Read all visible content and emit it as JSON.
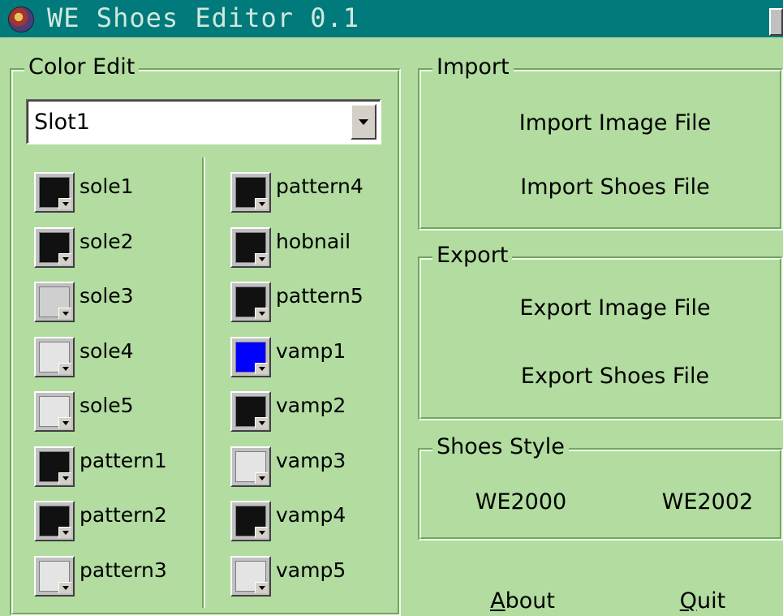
{
  "window": {
    "title": "WE Shoes Editor 0.1"
  },
  "color_edit": {
    "legend": "Color Edit",
    "slot_select": {
      "value": "Slot1"
    },
    "left_column": [
      {
        "label": "sole1",
        "color": "#111111"
      },
      {
        "label": "sole2",
        "color": "#111111"
      },
      {
        "label": "sole3",
        "color": "#cfcfcf"
      },
      {
        "label": "sole4",
        "color": "#e4e4e4"
      },
      {
        "label": "sole5",
        "color": "#e4e4e4"
      },
      {
        "label": "pattern1",
        "color": "#111111"
      },
      {
        "label": "pattern2",
        "color": "#111111"
      },
      {
        "label": "pattern3",
        "color": "#e4e4e4"
      }
    ],
    "right_column": [
      {
        "label": "pattern4",
        "color": "#111111"
      },
      {
        "label": "hobnail",
        "color": "#111111"
      },
      {
        "label": "pattern5",
        "color": "#111111"
      },
      {
        "label": "vamp1",
        "color": "#0000ff"
      },
      {
        "label": "vamp2",
        "color": "#111111"
      },
      {
        "label": "vamp3",
        "color": "#e4e4e4"
      },
      {
        "label": "vamp4",
        "color": "#111111"
      },
      {
        "label": "vamp5",
        "color": "#e4e4e4"
      }
    ]
  },
  "import_group": {
    "legend": "Import",
    "image_button": "Import Image File",
    "shoes_button": "Import Shoes File"
  },
  "export_group": {
    "legend": "Export",
    "image_button": "Export Image File",
    "shoes_button": "Export Shoes File"
  },
  "style_group": {
    "legend": "Shoes Style",
    "option_2000": "WE2000",
    "option_2002": "WE2002"
  },
  "footer": {
    "about_mnemonic": "A",
    "about_rest": "bout",
    "quit_mnemonic": "Q",
    "quit_rest": "uit"
  }
}
